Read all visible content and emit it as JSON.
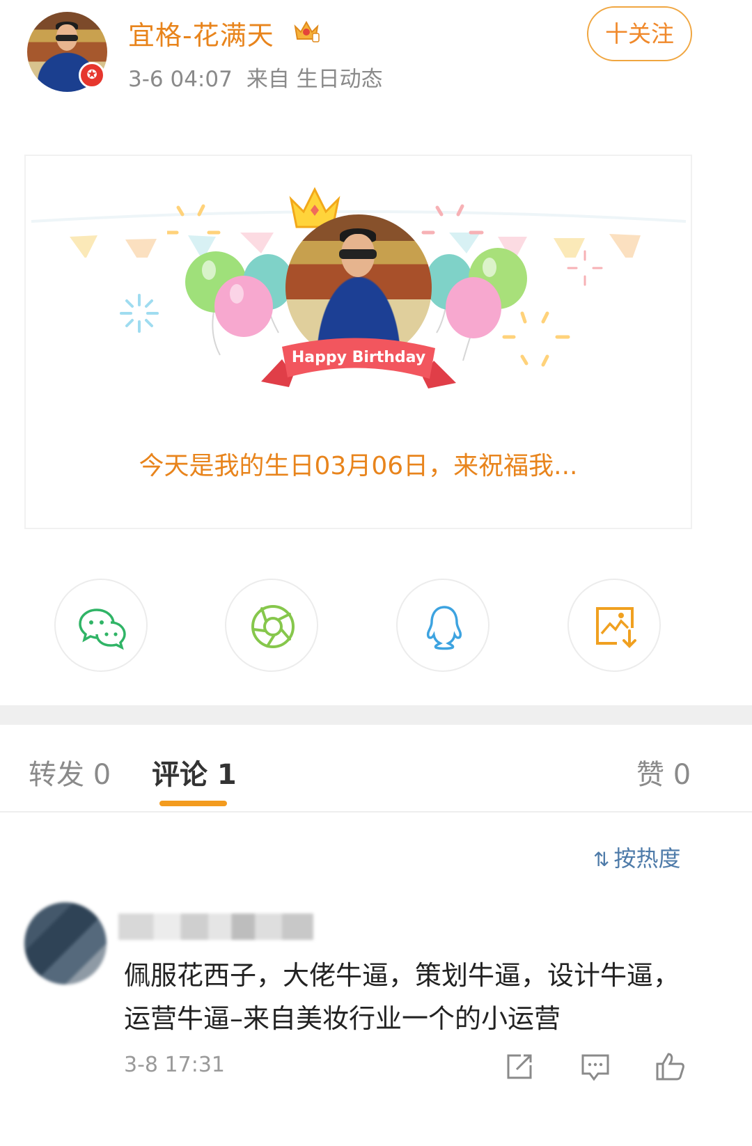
{
  "post": {
    "username": "宜格-花满天",
    "time": "3-6 04:07",
    "source": "来自 生日动态",
    "follow_label": "十关注"
  },
  "card": {
    "ribbon_text": "Happy Birthday",
    "message": "今天是我的生日03月06日，来祝福我..."
  },
  "share": [
    {
      "icon": "wechat-icon"
    },
    {
      "icon": "moments-icon"
    },
    {
      "icon": "qq-icon"
    },
    {
      "icon": "save-image-icon"
    }
  ],
  "tabs": {
    "repost": "转发 0",
    "comment": "评论 1",
    "like": "赞 0"
  },
  "sort": {
    "icon": "sort-icon",
    "label": "按热度"
  },
  "comment": {
    "text": "佩服花西子，大佬牛逼，策划牛逼，设计牛逼，运营牛逼–来自美妆行业一个的小运营",
    "time": "3-8 17:31"
  },
  "colors": {
    "accent": "#e8841c",
    "tab_indicator": "#f39b1e",
    "link": "#4e7ba9"
  }
}
